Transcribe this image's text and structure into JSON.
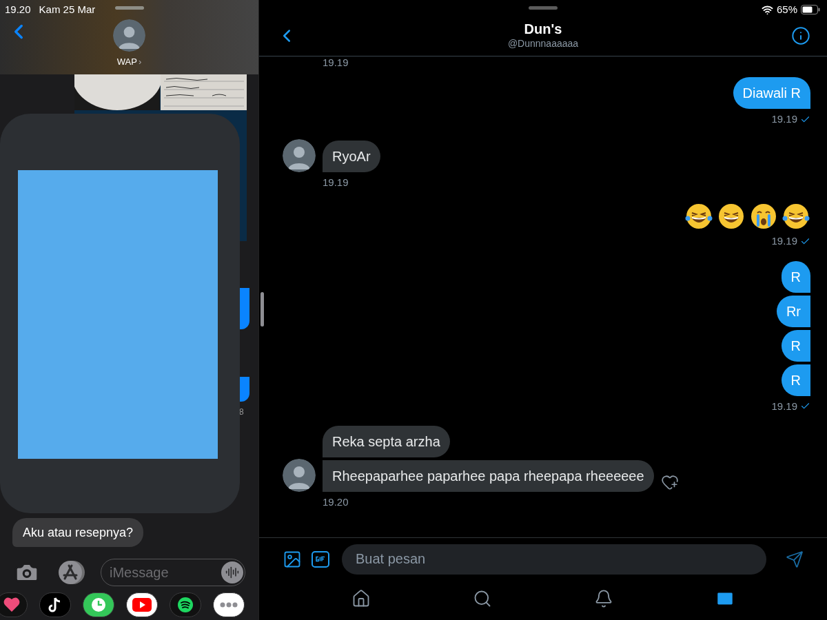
{
  "left_app": {
    "status_bar": {
      "time": "19.20",
      "date": "Kam 25 Mar"
    },
    "contact": {
      "name": "WAP",
      "chevron": "›"
    },
    "hidden_timestamp": "8",
    "last_message": {
      "text": "Aku atau resepnya?"
    },
    "composer": {
      "placeholder": "iMessage"
    }
  },
  "right_app": {
    "status_bar": {
      "battery": "65%"
    },
    "header": {
      "title": "Dun's",
      "handle": "@Dunnnaaaaaa"
    },
    "top_timestamp": "19.19",
    "messages": [
      {
        "kind": "sent",
        "bubbles": [
          "Diawali R"
        ],
        "time": "19.19",
        "read": true
      },
      {
        "kind": "received",
        "bubbles": [
          "RyoAr"
        ],
        "time": "19.19"
      },
      {
        "kind": "emoji",
        "time": "19.19",
        "read": true
      },
      {
        "kind": "sent",
        "bubbles": [
          "R",
          "Rr",
          "R",
          "R"
        ],
        "time": "19.19",
        "read": true
      },
      {
        "kind": "received",
        "bubbles": [
          "Reka septa arzha",
          "Rheepaparhee paparhee papa rheepapa rheeeeee"
        ],
        "time": "19.20",
        "like_button": true
      }
    ],
    "composer": {
      "placeholder": "Buat pesan"
    },
    "tabs": [
      {
        "kind": "home",
        "selected": false
      },
      {
        "kind": "search",
        "selected": false
      },
      {
        "kind": "notifications",
        "selected": false
      },
      {
        "kind": "messages",
        "selected": true
      }
    ]
  }
}
